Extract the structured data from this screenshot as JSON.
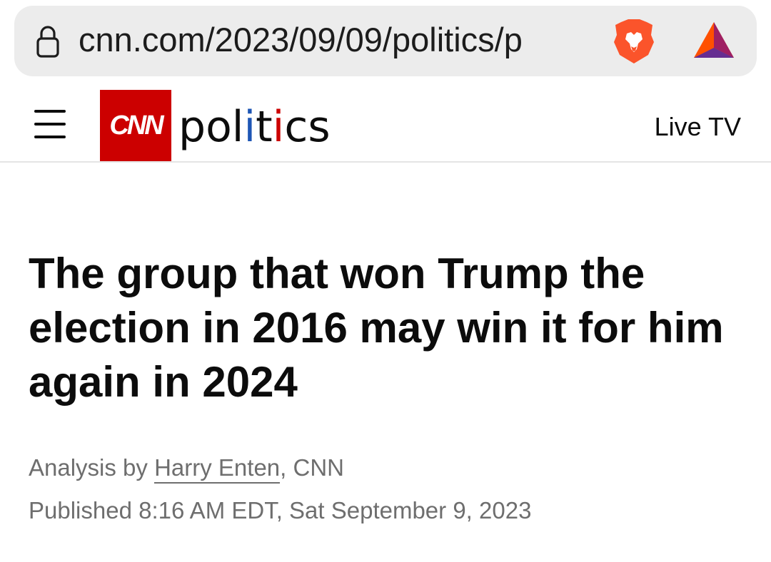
{
  "browser": {
    "url": "cnn.com/2023/09/09/politics/p",
    "lock_icon": "lock-icon",
    "brave_icon": "brave-lion-icon",
    "rewards_icon": "bat-triangle-icon"
  },
  "header": {
    "menu_icon": "hamburger-menu-icon",
    "brand": "CNN",
    "section_parts": [
      "pol",
      "i",
      "t",
      "i",
      "cs"
    ],
    "live_tv": "Live TV",
    "colors": {
      "brand_red": "#cc0000",
      "accent_blue": "#1e56b5"
    }
  },
  "article": {
    "headline": "The group that won Trump the election in 2016 may win it for him again in 2024",
    "byline_prefix": "Analysis by ",
    "author": "Harry Enten",
    "byline_suffix": ", CNN",
    "published": "Published 8:16 AM EDT, Sat September 9, 2023"
  }
}
